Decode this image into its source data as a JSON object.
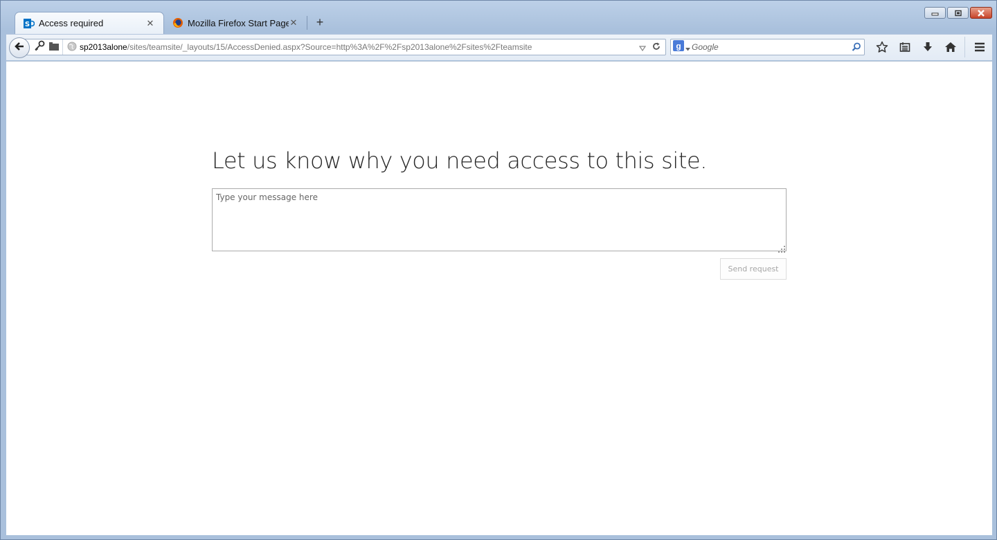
{
  "browser": {
    "tabs": [
      {
        "label": "Access required",
        "close": "✕",
        "active": true,
        "icon": "sharepoint-icon"
      },
      {
        "label": "Mozilla Firefox Start Page",
        "close": "✕",
        "active": false,
        "icon": "firefox-icon"
      }
    ],
    "new_tab": "+",
    "url": {
      "host": "sp2013alone",
      "path": "/sites/teamsite/_layouts/15/AccessDenied.aspx?Source=http%3A%2F%2Fsp2013alone%2Fsites%2Fteamsite"
    },
    "search": {
      "placeholder": "Google",
      "engine_icon": "google-icon"
    },
    "toolbar_icons": [
      "bookmark-star-icon",
      "reading-list-icon",
      "download-icon",
      "home-icon",
      "menu-icon"
    ]
  },
  "page": {
    "title": "Let us know why you need access to this site.",
    "message_placeholder": "Type your message here",
    "send_label": "Send request"
  },
  "colors": {
    "chrome_blue": "#a9c0dc",
    "sharepoint_blue": "#0072c6",
    "close_red": "#c8442a"
  }
}
